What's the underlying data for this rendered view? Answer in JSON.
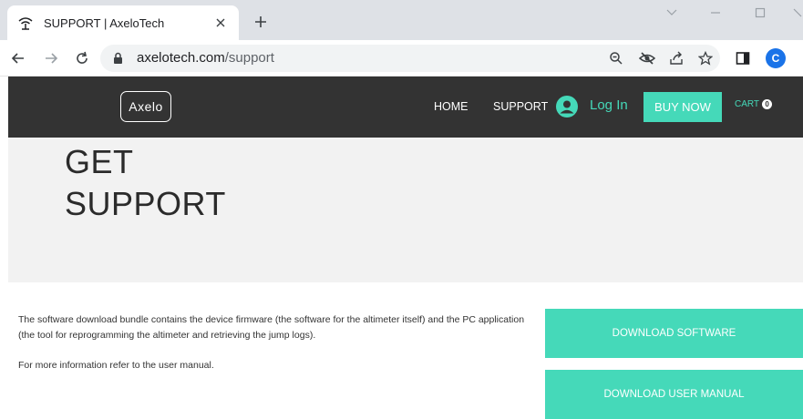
{
  "browser": {
    "tab": {
      "title": "SUPPORT | AxeloTech",
      "favicon": "wifi-signal-icon"
    },
    "new_tab_label": "+",
    "url": {
      "domain": "axelotech.com",
      "path": "/support"
    },
    "profile_initial": "C"
  },
  "site": {
    "logo_text": "Axelo",
    "nav": {
      "home": "HOME",
      "support": "SUPPORT",
      "login": "Log In",
      "buy_now": "BUY NOW",
      "cart": "CART",
      "cart_count": "0"
    },
    "hero": {
      "title": "GET SUPPORT"
    },
    "content": {
      "paragraph1": "The software download bundle contains the device firmware (the software for the altimeter itself) and the PC application (the tool for reprogramming the altimeter and retrieving the jump logs).",
      "paragraph2": "For more information refer to the user manual."
    },
    "buttons": {
      "download_software": "DOWNLOAD SOFTWARE",
      "download_manual": "DOWNLOAD USER MANUAL"
    }
  },
  "colors": {
    "accent": "#45d9b9",
    "header_bg": "#333333",
    "hero_bg": "#f2f2f2",
    "chrome_tab_bar": "#dee1e6"
  }
}
